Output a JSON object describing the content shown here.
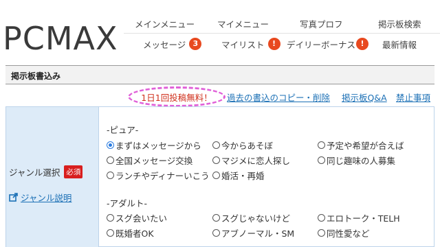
{
  "brand": {
    "logo_text": "PCMAX"
  },
  "nav": {
    "row1": [
      "メインメニュー",
      "マイメニュー",
      "写真プロフ",
      "掲示板検索"
    ],
    "row2": [
      {
        "label": "メッセージ",
        "badge": "3"
      },
      {
        "label": "マイリスト",
        "badge": "!"
      },
      {
        "label": "デイリーボーナス",
        "badge": "!"
      },
      {
        "label": "最新情報",
        "badge": ""
      }
    ]
  },
  "section": {
    "title": "掲示板書込み"
  },
  "links": {
    "free_note": "1日1回投稿無料！",
    "copy_delete": "過去の書込のコピー・削除",
    "qa": "掲示板Q&A",
    "prohibited": "禁止事項"
  },
  "form": {
    "genre_label": "ジャンル選択",
    "required_badge": "必須",
    "genre_help": "ジャンル説明",
    "groups": [
      {
        "heading": "-ピュア-",
        "options": [
          "まずはメッセージから",
          "今からあそぼ",
          "予定や希望が合えば",
          "全国メッセージ交換",
          "マジメに恋人探し",
          "同じ趣味の人募集",
          "ランチやディナーいこう",
          "婚活・再婚"
        ],
        "selected": "まずはメッセージから"
      },
      {
        "heading": "-アダルト-",
        "options": [
          "スグ会いたい",
          "スグじゃないけど",
          "エロトーク・TELH",
          "既婚者OK",
          "アブノーマル・SM",
          "同性愛など"
        ],
        "selected": ""
      }
    ]
  },
  "colors": {
    "badge": "#e8491f",
    "link": "#1a6fb5",
    "form_label_bg": "#ddebf8",
    "required": "#d81e1e",
    "highlight_ring": "#e060d8"
  }
}
